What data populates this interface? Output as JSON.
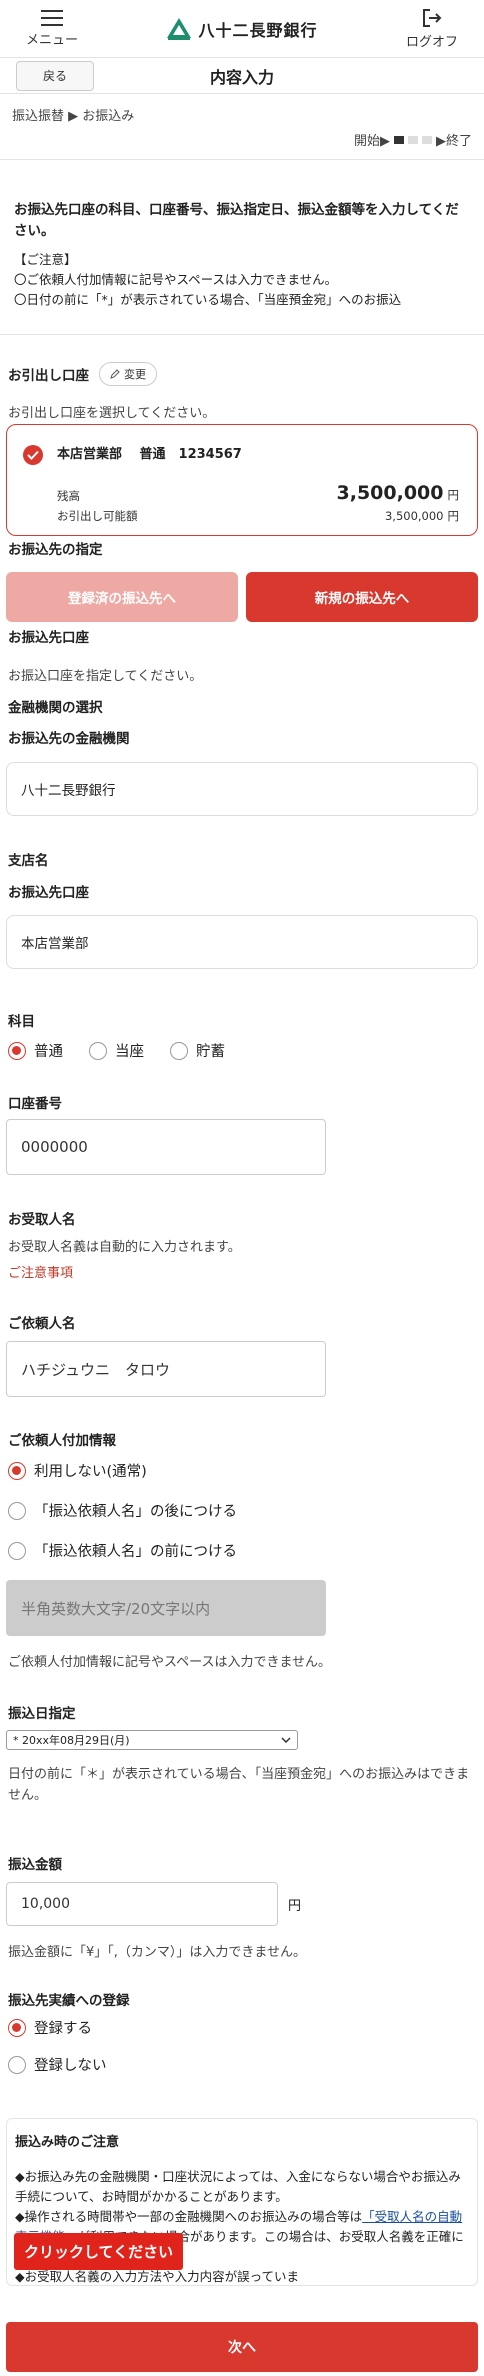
{
  "header": {
    "menu_label": "メニュー",
    "logo_text": "八十二長野銀行",
    "logout_label": "ログオフ",
    "back_label": "戻る",
    "page_title": "内容入力"
  },
  "breadcrumb": "振込振替 ▶ お振込み",
  "progress": {
    "start_label": "開始▶",
    "end_label": "▶終了",
    "steps_total": 3,
    "current_step": 1
  },
  "intro": {
    "lead": "お振込先口座の科目、口座番号、振込指定日、振込金額等を入力してください。",
    "notice_title": "【ご注意】",
    "notice_1": "〇ご依頼人付加情報に記号やスペースは入力できません。",
    "notice_2": "〇日付の前に「*」が表示されている場合、「当座預金宛」へのお振込"
  },
  "debit": {
    "title": "お引出し口座",
    "change_label": "変更",
    "instruction": "お引出し口座を選択してください。",
    "account_line": "本店営業部　 普通　1234567",
    "balance_label": "残高",
    "balance_value": "3,500,000",
    "balance_unit": "円",
    "available_label": "お引出し可能額",
    "available_value": "3,500,000",
    "available_unit": "円"
  },
  "destination": {
    "title": "お振込先の指定",
    "registered_btn": "登録済の振込先へ",
    "new_btn": "新規の振込先へ",
    "account_title": "お振込先口座",
    "account_instruction": "お振込口座を指定してください。",
    "bank_select_title": "金融機関の選択",
    "bank_label": "お振込先の金融機関",
    "bank_value": "八十二長野銀行",
    "branch_title": "支店名",
    "branch_label": "お振込先口座",
    "branch_value": "本店営業部"
  },
  "subject": {
    "title": "科目",
    "options": [
      "普通",
      "当座",
      "貯蓄"
    ],
    "selected": 0
  },
  "account_number": {
    "title": "口座番号",
    "value": "0000000"
  },
  "recipient": {
    "title": "お受取人名",
    "note": "お受取人名義は自動的に入力されます。",
    "caution": "ご注意事項"
  },
  "requester": {
    "title": "ご依頼人名",
    "value": "ハチジュウニ　タロウ"
  },
  "requester_extra": {
    "title": "ご依頼人付加情報",
    "options": [
      "利用しない(通常)",
      "「振込依頼人名」の後につける",
      "「振込依頼人名」の前につける"
    ],
    "selected": 0,
    "placeholder": "半角英数大文字/20文字以内",
    "note": "ご依頼人付加情報に記号やスペースは入力できません。"
  },
  "transfer_date": {
    "title": "振込日指定",
    "value": "* 20xx年08月29日(月)",
    "note": "日付の前に「＊」が表示されている場合、「当座預金宛」へのお振込みはできません。"
  },
  "amount": {
    "title": "振込金額",
    "value": "10,000",
    "unit": "円",
    "note": "振込金額に「¥」「,（カンマ）」は入力できません。"
  },
  "registration": {
    "title": "振込先実績への登録",
    "options": [
      "登録する",
      "登録しない"
    ],
    "selected": 0
  },
  "transfer_notice": {
    "title": "振込み時のご注意",
    "line_1": "◆お振込み先の金融機関・口座状況によっては、入金にならない場合やお振込み手続について、お時間がかかることがあります。",
    "line_2a": "◆操作される時間帯や一部の金融機関へのお振込みの場合等は",
    "line_2_link": "「受取人名の自動表示機能」",
    "line_2b": "が利用できない場合があります。この場合は、お受取人名義を正確に入力してください。",
    "line_3": "◆お受取人名義の入力方法や入力内容が誤っていま"
  },
  "click_badge": "クリックしてください",
  "next_label": "次へ",
  "colors": {
    "accent": "#d9382e",
    "accent_light": "#eea9a4",
    "link": "#1a4fa0"
  }
}
